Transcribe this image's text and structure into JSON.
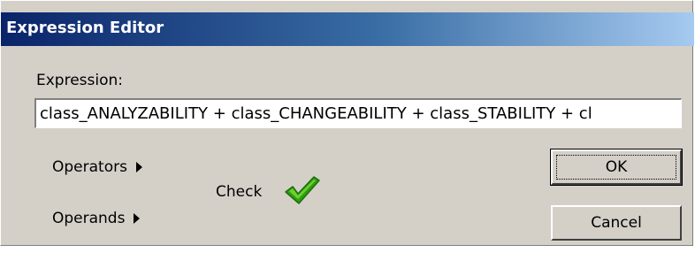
{
  "window": {
    "title": "Expression Editor"
  },
  "expression": {
    "label": "Expression:",
    "value": "class_ANALYZABILITY + class_CHANGEABILITY + class_STABILITY + cl"
  },
  "menus": {
    "operators_label": "Operators",
    "operands_label": "Operands"
  },
  "check": {
    "label": "Check",
    "icon": "checkmark-icon",
    "status_color": "#3cb31a"
  },
  "buttons": {
    "ok_label": "OK",
    "cancel_label": "Cancel"
  },
  "colors": {
    "titlebar_start": "#0a246a",
    "titlebar_end": "#a6caf0",
    "dialog_bg": "#d4d0c8"
  }
}
